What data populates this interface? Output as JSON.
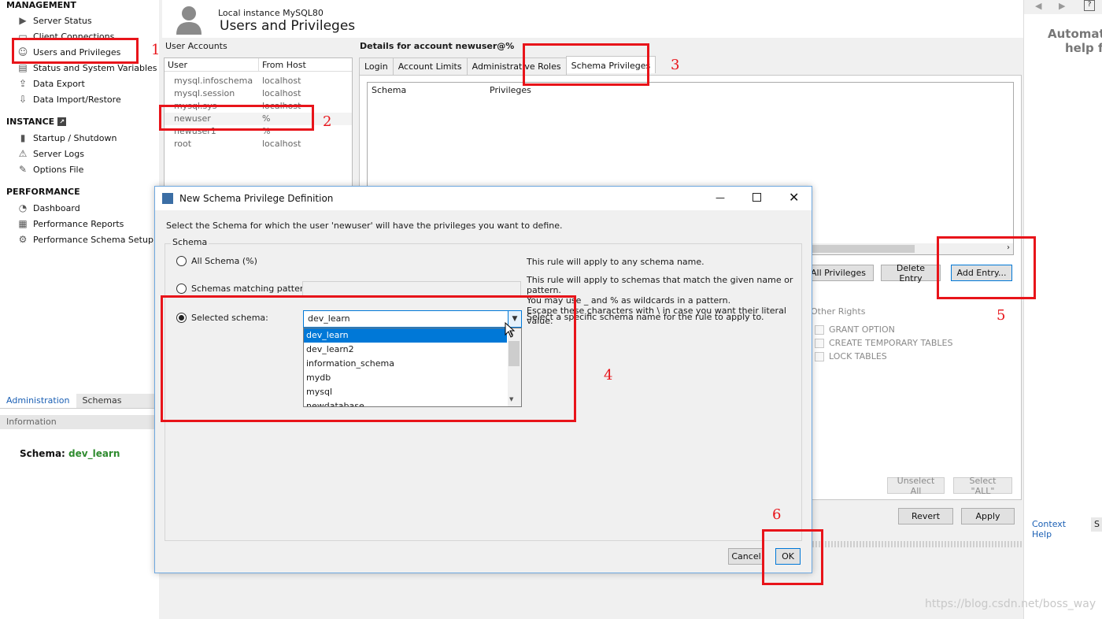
{
  "sidebar": {
    "management_header": "MANAGEMENT",
    "management_items": [
      "Server Status",
      "Client Connections",
      "Users and Privileges",
      "Status and System Variables",
      "Data Export",
      "Data Import/Restore"
    ],
    "instance_header": "INSTANCE",
    "instance_items": [
      "Startup / Shutdown",
      "Server Logs",
      "Options File"
    ],
    "performance_header": "PERFORMANCE",
    "performance_items": [
      "Dashboard",
      "Performance Reports",
      "Performance Schema Setup"
    ],
    "tabs": [
      "Administration",
      "Schemas"
    ],
    "info_label": "Information",
    "schema_label": "Schema:",
    "schema_value": "dev_learn"
  },
  "header": {
    "subtitle": "Local instance MySQL80",
    "title": "Users and Privileges"
  },
  "user_accounts": {
    "label": "User Accounts",
    "columns": [
      "User",
      "From Host"
    ],
    "rows": [
      {
        "user": "mysql.infoschema",
        "host": "localhost"
      },
      {
        "user": "mysql.session",
        "host": "localhost"
      },
      {
        "user": "mysql.sys",
        "host": "localhost"
      },
      {
        "user": "newuser",
        "host": "%"
      },
      {
        "user": "newuser1",
        "host": "%"
      },
      {
        "user": "root",
        "host": "localhost"
      }
    ]
  },
  "details": {
    "title": "Details for account newuser@%",
    "tabs": [
      "Login",
      "Account Limits",
      "Administrative Roles",
      "Schema Privileges"
    ],
    "columns": [
      "Schema",
      "Privileges"
    ],
    "buttons": {
      "revoke_all": "All Privileges",
      "delete_entry": "Delete Entry",
      "add_entry": "Add Entry...",
      "unselect_all": "Unselect All",
      "select_all": "Select \"ALL\"",
      "revert": "Revert",
      "apply": "Apply"
    },
    "other_rights_label": "Other Rights",
    "other_rights": [
      "GRANT OPTION",
      "CREATE TEMPORARY TABLES",
      "LOCK TABLES"
    ]
  },
  "right_panel": {
    "line1": "Automat",
    "line2": "help f",
    "tabs": [
      "Context Help",
      "S"
    ]
  },
  "dialog": {
    "title": "New Schema Privilege Definition",
    "instruction": "Select the Schema for which the user 'newuser' will have the privileges you want to define.",
    "group_label": "Schema",
    "opt_all": "All Schema (%)",
    "opt_all_desc": "This rule will apply to any schema name.",
    "opt_pattern": "Schemas matching pattern:",
    "opt_pattern_desc1": "This rule will apply to schemas that match the given name or pattern.",
    "opt_pattern_desc2": "You may use _ and % as wildcards in a pattern.",
    "opt_pattern_desc3": "Escape these characters with \\ in case you want their literal value.",
    "opt_selected": "Selected schema:",
    "opt_selected_desc": "Select a specific schema name for the rule to apply to.",
    "combo_value": "dev_learn",
    "options": [
      "dev_learn",
      "dev_learn2",
      "information_schema",
      "mydb",
      "mysql",
      "newdatabase"
    ],
    "cancel": "Cancel",
    "ok": "OK"
  },
  "annotations": [
    "1",
    "2",
    "3",
    "4",
    "5",
    "6"
  ],
  "watermark": "https://blog.csdn.net/boss_way",
  "colors": {
    "annotation": "#e8141a",
    "selection": "#0078d7",
    "schema_value": "#2e8b2e"
  }
}
